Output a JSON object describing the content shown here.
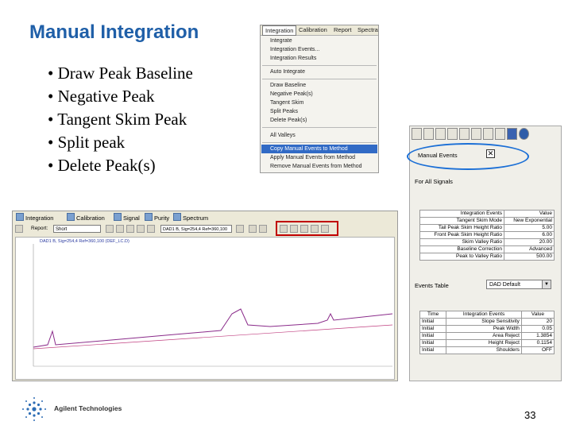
{
  "slide": {
    "title": "Manual Integration",
    "bullets": [
      "• Draw Peak Baseline",
      "• Negative Peak",
      "• Tangent Skim Peak",
      "• Split peak",
      "• Delete Peak(s)"
    ],
    "page_number": "33"
  },
  "menu": {
    "bar": [
      "Integration",
      "Calibration",
      "Report",
      "Spectra"
    ],
    "items": [
      "Integrate",
      "Integration Events...",
      "Integration Results",
      "Auto Integrate",
      "Draw Baseline",
      "Negative Peak(s)",
      "Tangent Skim",
      "Split Peaks",
      "Delete Peak(s)",
      "All Valleys",
      "Copy Manual Events to Method",
      "Apply Manual Events from Method",
      "Remove Manual Events from Method"
    ],
    "highlighted": "Copy Manual Events to Method"
  },
  "props_panel": {
    "manual_events_label": "Manual Events",
    "manual_events_checked": true,
    "all_signals_label": "For All Signals",
    "events_headers": [
      "Integration Events",
      "Value"
    ],
    "events_rows": [
      [
        "Tangent Skim Mode",
        "New Exponential"
      ],
      [
        "Tail Peak Skim Height Ratio",
        "5.00"
      ],
      [
        "Front Peak Skim Height Ratio",
        "6.00"
      ],
      [
        "Skim Valley Ratio",
        "20.00"
      ],
      [
        "Baseline Correction",
        "Advanced"
      ],
      [
        "Peak to Valley Ratio",
        "500.00"
      ]
    ],
    "event_table_label": "Events Table",
    "event_table_value": "DAD Default",
    "timed_headers": [
      "Time",
      "Integration Events",
      "Value"
    ],
    "timed_rows": [
      [
        "Initial",
        "Slope Sensitivity",
        "20"
      ],
      [
        "Initial",
        "Peak Width",
        "0.05"
      ],
      [
        "Initial",
        "Area Reject",
        "1.3854"
      ],
      [
        "Initial",
        "Height Reject",
        "0.1154"
      ],
      [
        "Initial",
        "Shoulders",
        "OFF"
      ]
    ]
  },
  "chrom_window": {
    "tabs": [
      "Integration",
      "Calibration",
      "Signal",
      "Purity",
      "Spectrum"
    ],
    "report_label": "Report:",
    "report_value": "Short",
    "signal_value": "DAD1 B, Sig=254,4 Ref=360,100",
    "plot_header": "DAD1 B, Sig=254,4 Ref=360,100 (DEF_LC.D)"
  },
  "footer": {
    "brand": "Agilent Technologies"
  },
  "colors": {
    "title": "#1f5fa8",
    "menu_highlight": "#316ac5",
    "oval": "#1b6fd6",
    "red_box": "#c00000",
    "trace": "#8a2b8a"
  }
}
